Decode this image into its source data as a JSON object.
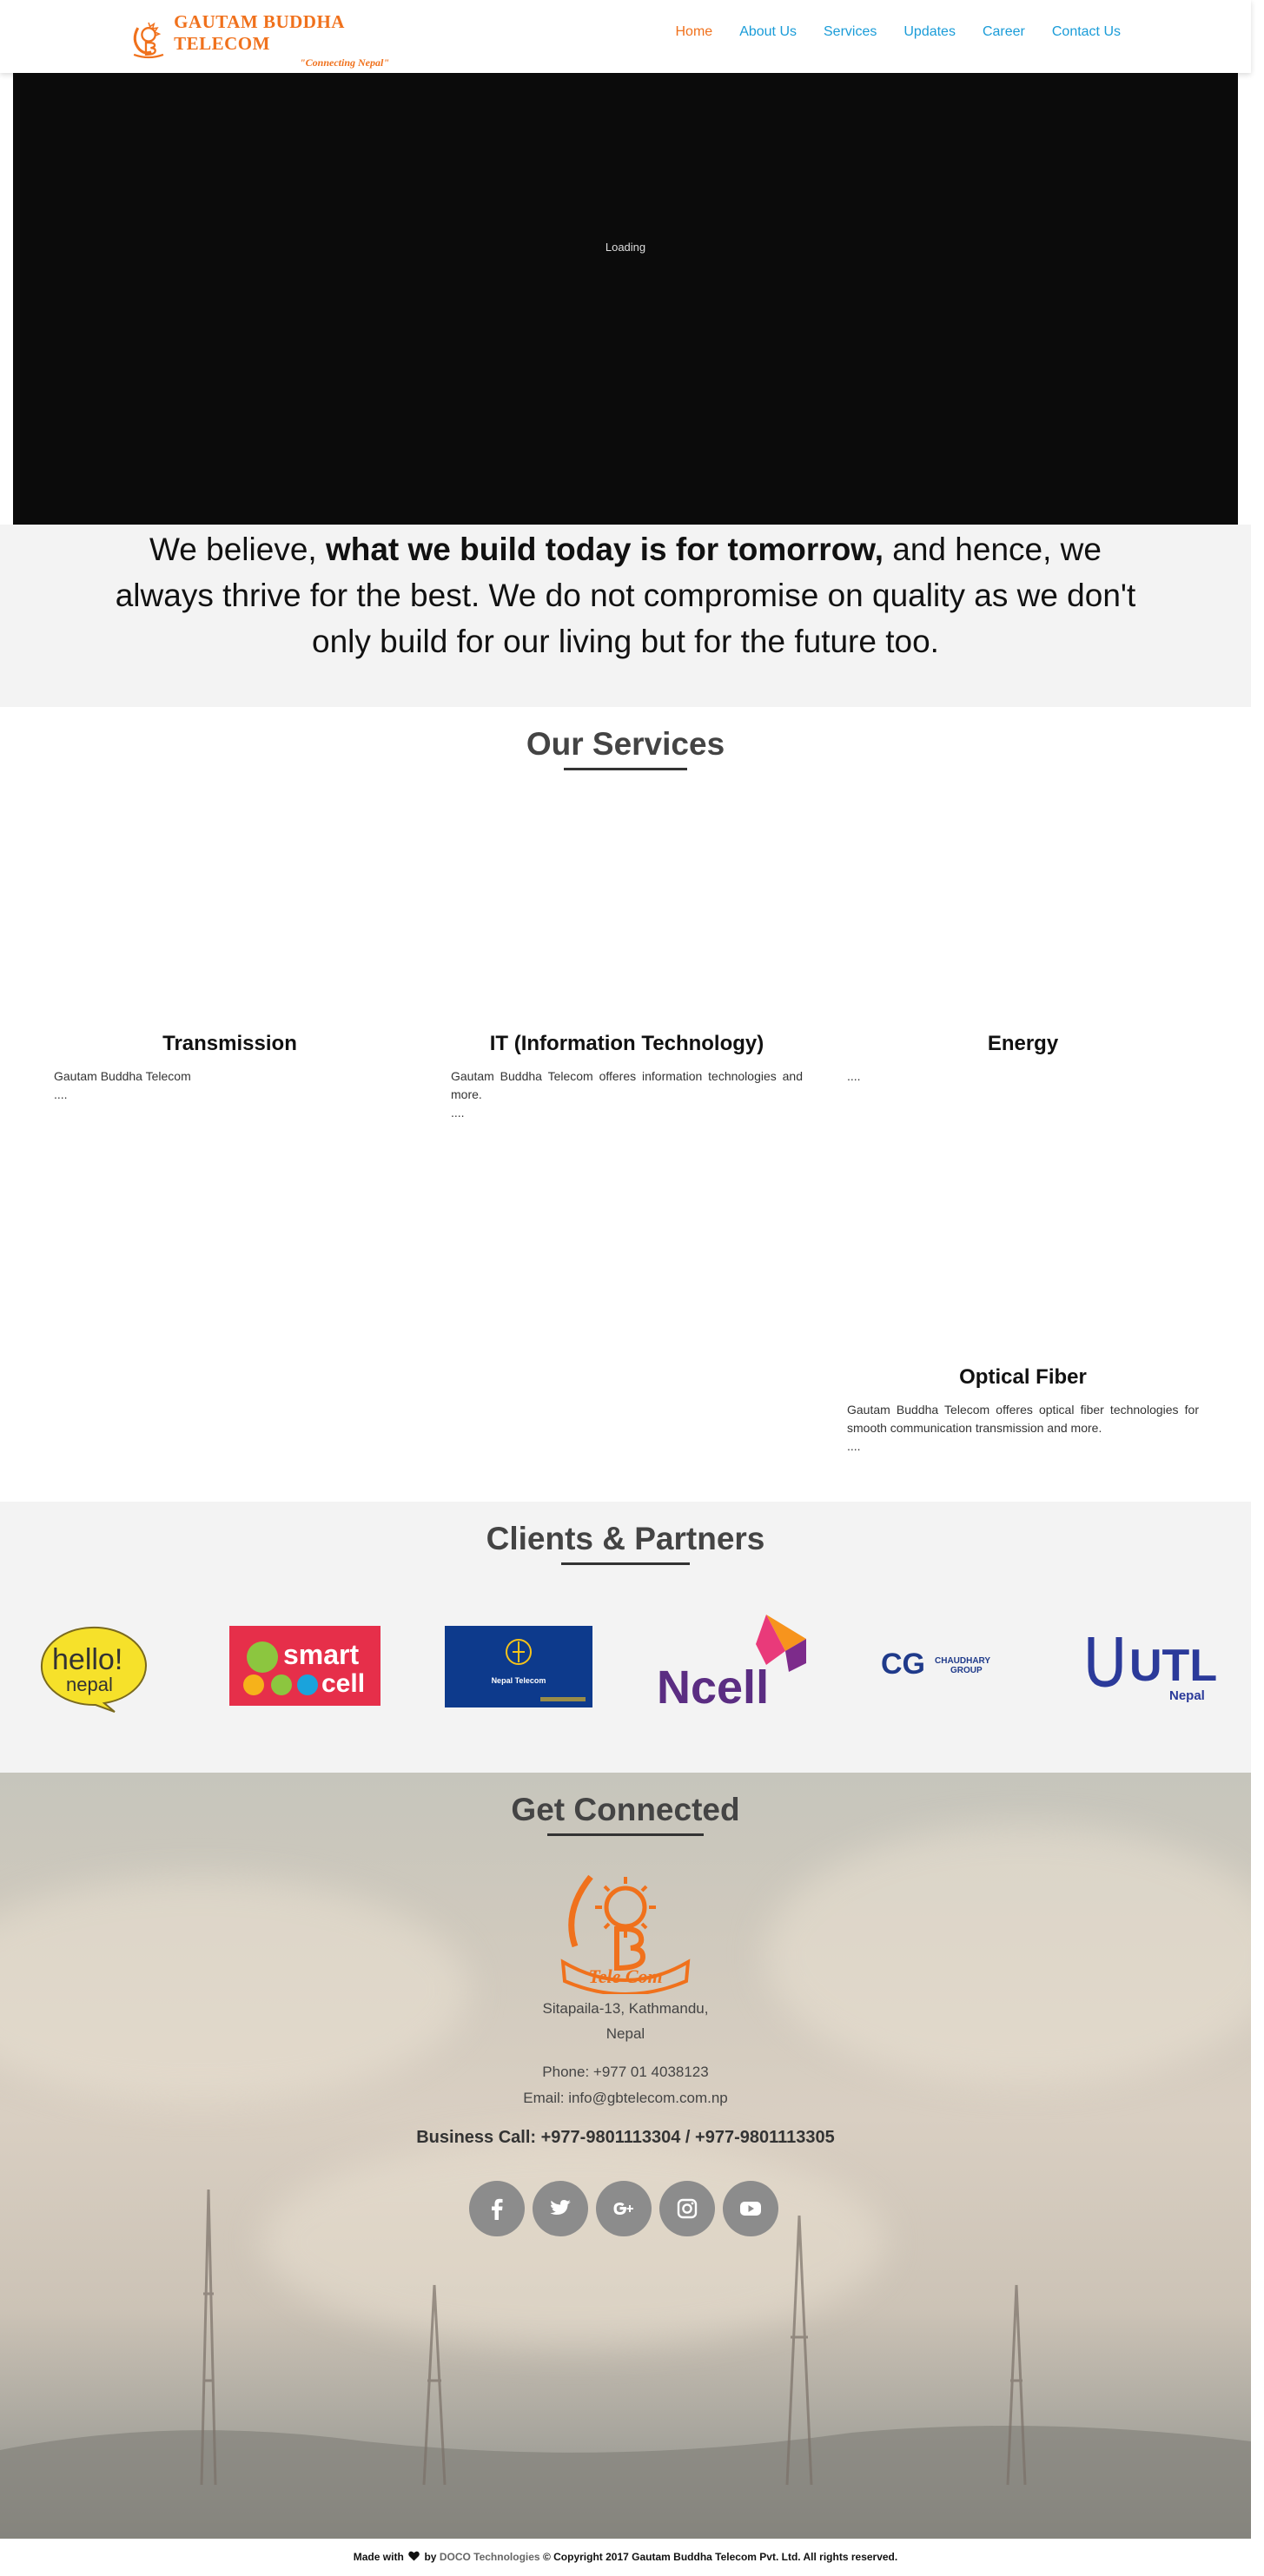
{
  "header": {
    "logo_name": "GAUTAM BUDDHA TELECOM",
    "logo_tagline": "\"Connecting Nepal\"",
    "nav": [
      {
        "label": "Home",
        "active": true
      },
      {
        "label": "About Us",
        "active": false
      },
      {
        "label": "Services",
        "active": false
      },
      {
        "label": "Updates",
        "active": false
      },
      {
        "label": "Career",
        "active": false
      },
      {
        "label": "Contact Us",
        "active": false
      }
    ]
  },
  "video": {
    "loading_text": "Loading"
  },
  "belief": {
    "prefix": "We believe, ",
    "bold": "what we build today is for tomorrow,",
    "suffix": " and hence, we always thrive for the best. We do not compromise on quality as we don't only build for our living but for the future too."
  },
  "services": {
    "heading_light": "Our ",
    "heading_bold": "Services",
    "items": [
      {
        "title": "Transmission",
        "text": "Gautam Buddha Telecom",
        "more": "...."
      },
      {
        "title": "IT (Information Technology)",
        "text": "Gautam Buddha Telecom offeres information technologies and more.",
        "more": "...."
      },
      {
        "title": "Energy",
        "text": "",
        "more": "...."
      },
      {
        "title": "Optical Fiber",
        "text": "Gautam Buddha Telecom offeres optical fiber technologies for smooth communication transmission and more.",
        "more": "...."
      }
    ]
  },
  "clients": {
    "heading_bold": "Clients",
    "heading_light": " & Partners",
    "logos": [
      {
        "name": "hello-nepal-logo",
        "word1": "hello!",
        "word2": "nepal"
      },
      {
        "name": "smart-cell-logo",
        "word": "smart cell"
      },
      {
        "name": "nepal-telecom-logo",
        "word": "Nepal Telecom"
      },
      {
        "name": "ncell-logo",
        "word": "Ncell"
      },
      {
        "name": "cg-chaudhary-group-logo",
        "word1": "CG",
        "word2": "CHAUDHARY GROUP"
      },
      {
        "name": "utl-nepal-logo",
        "word1": "UTL",
        "word2": "Nepal"
      }
    ]
  },
  "connected": {
    "heading_light": "Get ",
    "heading_bold": "Connected",
    "logo_text": "Tele Com",
    "address_line1": "Sitapaila-13, Kathmandu,",
    "address_line2": "Nepal",
    "phone": "Phone: +977 01 4038123",
    "email": "Email: info@gbtelecom.com.np",
    "business": "Business Call: +977-9801113304 / +977-9801113305",
    "social": [
      "facebook-icon",
      "twitter-icon",
      "google-plus-icon",
      "instagram-icon",
      "youtube-icon"
    ]
  },
  "footer": {
    "made_with": "Made with",
    "by": " by ",
    "company": "DOCO Technologies",
    "copyright": " © Copyright 2017 Gautam Buddha Telecom Pvt. Ltd. All rights reserved."
  },
  "colors": {
    "brand_orange": "#f0711c",
    "nav_blue": "#1a9cd8",
    "social_grey": "#8c8c8c"
  }
}
